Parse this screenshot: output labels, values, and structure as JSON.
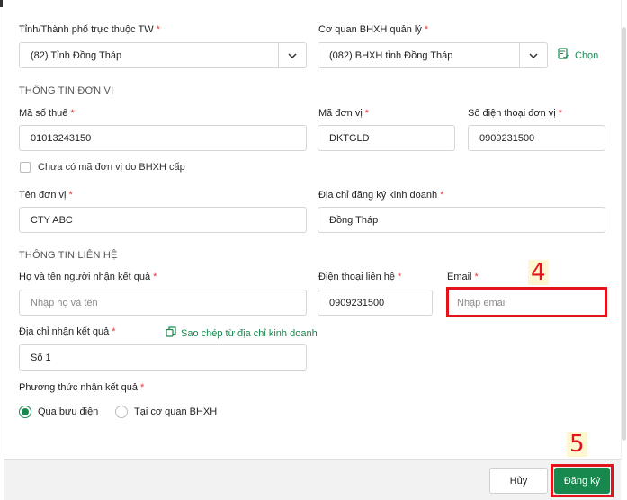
{
  "colors": {
    "accent": "#17894f",
    "annotation": "#e0141a",
    "annotation_bg": "#fff6d2"
  },
  "province": {
    "label": "Tỉnh/Thành phố trực thuộc TW",
    "value": "(82) Tỉnh Đồng Tháp"
  },
  "agency": {
    "label": "Cơ quan BHXH quản lý",
    "value": "(082) BHXH tỉnh Đồng Tháp",
    "choose_label": "Chọn"
  },
  "unit_info": {
    "section_title": "THÔNG TIN ĐƠN VỊ",
    "tax_code": {
      "label": "Mã số thuế",
      "value": "01013243150"
    },
    "unit_code": {
      "label": "Mã đơn vị",
      "value": "DKTGLD"
    },
    "unit_phone": {
      "label": "Số điện thoại đơn vị",
      "value": "0909231500"
    },
    "no_code_checkbox": {
      "label": "Chưa có mã đơn vị do BHXH cấp",
      "checked": false
    },
    "unit_name": {
      "label": "Tên đơn vị",
      "value": "CTY ABC"
    },
    "business_address": {
      "label": "Địa chỉ đăng ký kinh doanh",
      "value": "Đồng Tháp"
    }
  },
  "contact_info": {
    "section_title": "THÔNG TIN LIÊN HỆ",
    "recipient_name": {
      "label": "Họ và tên người nhận kết quả",
      "placeholder": "Nhập họ và tên"
    },
    "contact_phone": {
      "label": "Điện thoại liên hệ",
      "value": "0909231500"
    },
    "email": {
      "label": "Email",
      "placeholder": "Nhập email"
    },
    "result_address": {
      "label": "Địa chỉ nhận kết quả",
      "value": "Số 1",
      "copy_link": "Sao chép từ địa chỉ kinh doanh"
    },
    "receive_method": {
      "label": "Phương thức nhận kết quả",
      "options": [
        "Qua bưu điện",
        "Tại cơ quan BHXH"
      ],
      "selected": "Qua bưu điện"
    }
  },
  "footer": {
    "cancel_label": "Hủy",
    "register_label": "Đăng ký"
  },
  "annotations": {
    "email_step": "4",
    "register_step": "5"
  }
}
